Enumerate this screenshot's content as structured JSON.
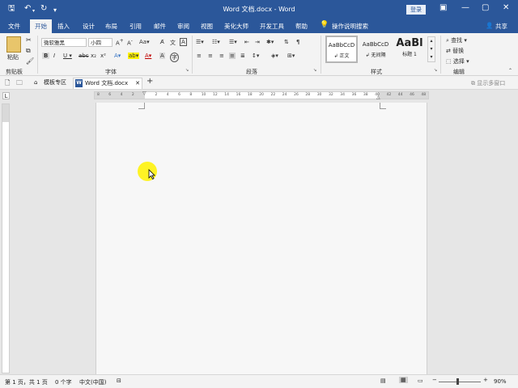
{
  "window": {
    "title": "Word 文档.docx - Word",
    "login_label": "登录",
    "minimize": "—",
    "restore": "▢",
    "close": "✕",
    "ribbon_options": "▣"
  },
  "tabs": [
    "文件",
    "开始",
    "插入",
    "设计",
    "布局",
    "引用",
    "邮件",
    "审阅",
    "视图",
    "美化大师",
    "开发工具",
    "帮助"
  ],
  "active_tab": "开始",
  "tell_me": "操作说明搜索",
  "share": "共享",
  "ribbon": {
    "clipboard": {
      "paste": "粘贴",
      "label": "剪贴板"
    },
    "font": {
      "name": "微软雅黑",
      "size": "小四",
      "label": "字体"
    },
    "paragraph": {
      "label": "段落"
    },
    "styles": {
      "label": "样式",
      "items": [
        {
          "preview": "AaBbCcD",
          "name": "正文"
        },
        {
          "preview": "AaBbCcD",
          "name": "无间隔"
        },
        {
          "preview": "AaBl",
          "name": "标题 1"
        }
      ]
    },
    "editing": {
      "label": "编辑",
      "find": "查找",
      "replace": "替换",
      "select": "选择"
    }
  },
  "doc_tabs": {
    "template": "模板专区",
    "document": "Word 文档.docx",
    "close": "✕",
    "add": "+",
    "multi_window": "显示多窗口"
  },
  "ruler_numbers": [
    "8",
    "6",
    "4",
    "2",
    "",
    "2",
    "4",
    "6",
    "8",
    "10",
    "12",
    "14",
    "16",
    "18",
    "20",
    "22",
    "24",
    "26",
    "28",
    "30",
    "32",
    "34",
    "36",
    "38",
    "40",
    "42",
    "44",
    "46",
    "48"
  ],
  "status": {
    "page": "第 1 页，共 1 页",
    "words": "0 个字",
    "language": "中文(中国)",
    "zoom": "90%"
  },
  "colors": {
    "brand": "#2b579a",
    "ribbon": "#f3f3f3",
    "highlight": "#fff200"
  }
}
